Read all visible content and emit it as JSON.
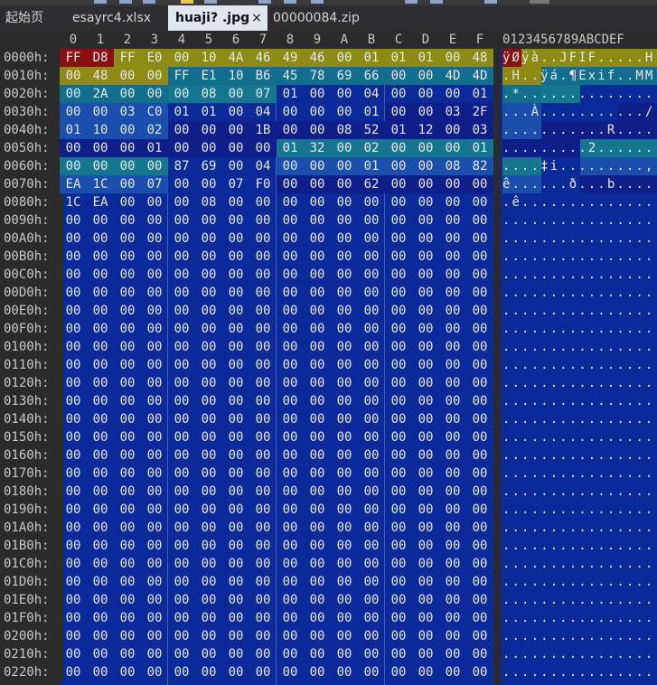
{
  "tabs": [
    {
      "label": "起始页",
      "active": false
    },
    {
      "label": "esayrc4.xlsx",
      "active": false
    },
    {
      "label": "huaji?  .jpg",
      "active": true
    },
    {
      "label": "00000084.zip",
      "active": false
    }
  ],
  "close_glyph": "×",
  "column_headers": [
    "0",
    "1",
    "2",
    "3",
    "4",
    "5",
    "6",
    "7",
    "8",
    "9",
    "A",
    "B",
    "C",
    "D",
    "E",
    "F"
  ],
  "ascii_header": "0123456789ABCDEF",
  "rows": [
    {
      "addr": "0000h:",
      "bytes": [
        "FF",
        "D8",
        "FF",
        "E0",
        "00",
        "10",
        "4A",
        "46",
        "49",
        "46",
        "00",
        "01",
        "01",
        "01",
        "00",
        "48"
      ],
      "ascii": "ÿØÿà..JFIF.....H"
    },
    {
      "addr": "0010h:",
      "bytes": [
        "00",
        "48",
        "00",
        "00",
        "FF",
        "E1",
        "10",
        "B6",
        "45",
        "78",
        "69",
        "66",
        "00",
        "00",
        "4D",
        "4D"
      ],
      "ascii": ".H..ÿá.¶Exif..MM"
    },
    {
      "addr": "0020h:",
      "bytes": [
        "00",
        "2A",
        "00",
        "00",
        "00",
        "08",
        "00",
        "07",
        "01",
        "00",
        "00",
        "04",
        "00",
        "00",
        "00",
        "01"
      ],
      "ascii": ".*.............."
    },
    {
      "addr": "0030h:",
      "bytes": [
        "00",
        "00",
        "03",
        "C0",
        "01",
        "01",
        "00",
        "04",
        "00",
        "00",
        "00",
        "01",
        "00",
        "00",
        "03",
        "2F"
      ],
      "ascii": "...À.........../"
    },
    {
      "addr": "0040h:",
      "bytes": [
        "01",
        "10",
        "00",
        "02",
        "00",
        "00",
        "00",
        "1B",
        "00",
        "00",
        "08",
        "52",
        "01",
        "12",
        "00",
        "03"
      ],
      "ascii": "...........R...."
    },
    {
      "addr": "0050h:",
      "bytes": [
        "00",
        "00",
        "00",
        "01",
        "00",
        "00",
        "00",
        "00",
        "01",
        "32",
        "00",
        "02",
        "00",
        "00",
        "00",
        "01"
      ],
      "ascii": ".........2......"
    },
    {
      "addr": "0060h:",
      "bytes": [
        "00",
        "00",
        "00",
        "00",
        "87",
        "69",
        "00",
        "04",
        "00",
        "00",
        "00",
        "01",
        "00",
        "00",
        "08",
        "82"
      ],
      "ascii": "....‡i.........,"
    },
    {
      "addr": "0070h:",
      "bytes": [
        "EA",
        "1C",
        "00",
        "07",
        "00",
        "00",
        "07",
        "F0",
        "00",
        "00",
        "00",
        "62",
        "00",
        "00",
        "00",
        "00"
      ],
      "ascii": "ê......ð...b...."
    },
    {
      "addr": "0080h:",
      "bytes": [
        "1C",
        "EA",
        "00",
        "00",
        "00",
        "08",
        "00",
        "00",
        "00",
        "00",
        "00",
        "00",
        "00",
        "00",
        "00",
        "00"
      ],
      "ascii": ".ê.............."
    }
  ],
  "zero_row_addresses": [
    "0090h:",
    "00A0h:",
    "00B0h:",
    "00C0h:",
    "00D0h:",
    "00E0h:",
    "00F0h:",
    "0100h:",
    "0110h:",
    "0120h:",
    "0130h:",
    "0140h:",
    "0150h:",
    "0160h:",
    "0170h:",
    "0180h:",
    "0190h:",
    "01A0h:",
    "01B0h:",
    "01C0h:",
    "01D0h:",
    "01E0h:",
    "01F0h:",
    "0200h:",
    "0210h:",
    "0220h:"
  ],
  "zero_byte": "00",
  "zero_ascii": "................",
  "colors": {
    "editor_bg": "#0a2a9a",
    "soi_marker": "#8b1010",
    "app0_segment": "#8c8c14",
    "app1_header": "#0f6f8c",
    "ifd_entry_a": "#1a4fae",
    "ifd_entry_b": "#0e1f8a",
    "ifd_teal": "#15778f",
    "tab_active_bg": "#dfe6ee"
  }
}
